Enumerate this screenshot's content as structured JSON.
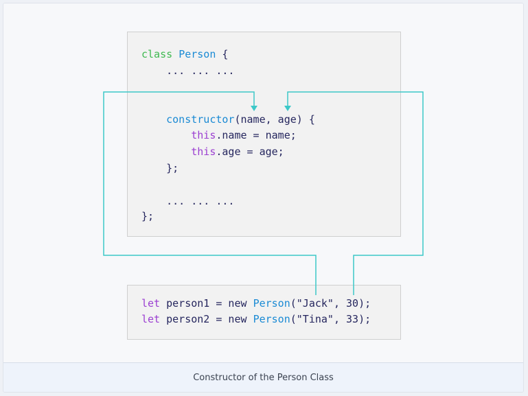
{
  "caption": "Constructor of the Person Class",
  "colors": {
    "arrow": "#3cc8c8",
    "keyword_class": "#3fb950",
    "identifier": "#1a8ad4",
    "keyword_this": "#9b3fd1",
    "text": "#25265e"
  },
  "class_code": {
    "line1": {
      "kw": "class",
      "name": "Person",
      "rest": " {"
    },
    "line2": "    ... ... ...",
    "line3": {
      "indent": "    ",
      "fn": "constructor",
      "rest": "(name, age) {"
    },
    "line4": {
      "indent": "        ",
      "kw": "this",
      "rest": ".name = name;"
    },
    "line5": {
      "indent": "        ",
      "kw": "this",
      "rest": ".age = age;"
    },
    "line6": "    };",
    "line7": "    ... ... ...",
    "line8": "};"
  },
  "usage_code": {
    "line1": {
      "kw": "let",
      "mid": " person1 = new ",
      "cls": "Person",
      "rest": "(\"Jack\", 30);"
    },
    "line2": {
      "kw": "let",
      "mid": " person2 = new ",
      "cls": "Person",
      "rest": "(\"Tina\", 33);"
    }
  }
}
